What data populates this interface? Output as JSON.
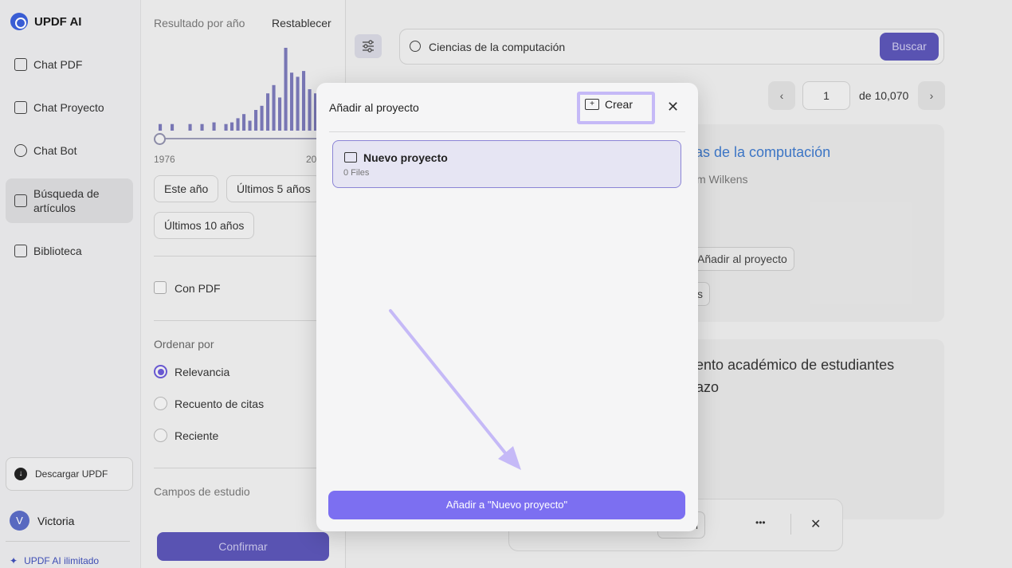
{
  "app": {
    "name": "UPDF AI"
  },
  "sidebar": {
    "items": [
      {
        "label": "Chat PDF"
      },
      {
        "label": "Chat Proyecto"
      },
      {
        "label": "Chat Bot"
      },
      {
        "label": "Búsqueda de artículos",
        "line1": "Búsqueda de",
        "line2": "artículos"
      },
      {
        "label": "Biblioteca"
      }
    ],
    "download": "Descargar UPDF",
    "user": {
      "initial": "V",
      "name": "Victoria"
    },
    "unlimited": "UPDF AI ilimitado"
  },
  "filters": {
    "title": "Resultado por año",
    "reset": "Restablecer",
    "histogram_levels": [
      0.08,
      0,
      0.08,
      0,
      0,
      0.08,
      0,
      0.08,
      0,
      0.1,
      0,
      0.08,
      0.1,
      0.15,
      0.2,
      0.12,
      0.25,
      0.3,
      0.45,
      0.55,
      0.4,
      1.0,
      0.7,
      0.65,
      0.72,
      0.5,
      0.45,
      0.35
    ],
    "year_start": "1976",
    "year_end": "20",
    "chips": [
      "Este año",
      "Últimos 5 años",
      "Últimos 10 años"
    ],
    "with_pdf": "Con PDF",
    "sort_title": "Ordenar por",
    "sort_options": [
      {
        "label": "Relevancia",
        "selected": true
      },
      {
        "label": "Recuento de citas",
        "selected": false
      },
      {
        "label": "Reciente",
        "selected": false
      }
    ],
    "fields_title": "Campos de estudio",
    "confirm": "Confirmar"
  },
  "search": {
    "value": "Ciencias de la computación",
    "button": "Buscar"
  },
  "pagination": {
    "prev": "‹",
    "page": "1",
    "total": "de 10,070",
    "next": "›"
  },
  "results": {
    "card1_title": "as de la computación",
    "card1_author": "m Wilkens",
    "card1_add": "Añadir al proyecto",
    "card1_btn2": "s",
    "card2_line1": "ento académico de estudiantes",
    "card2_line2": "azo",
    "floating_summary": "sumen",
    "floating_more": "•••",
    "floating_close": "✕"
  },
  "modal": {
    "title": "Añadir al proyecto",
    "create": "Crear",
    "close": "✕",
    "project": {
      "name": "Nuevo proyecto",
      "files": "0 Files"
    },
    "add_button": "Añadir a \"Nuevo proyecto\""
  },
  "colors": {
    "accent": "#7c6ff1",
    "highlight": "#c5b9f7",
    "primary_dark": "#5b55b6",
    "link": "#3e78c9"
  }
}
